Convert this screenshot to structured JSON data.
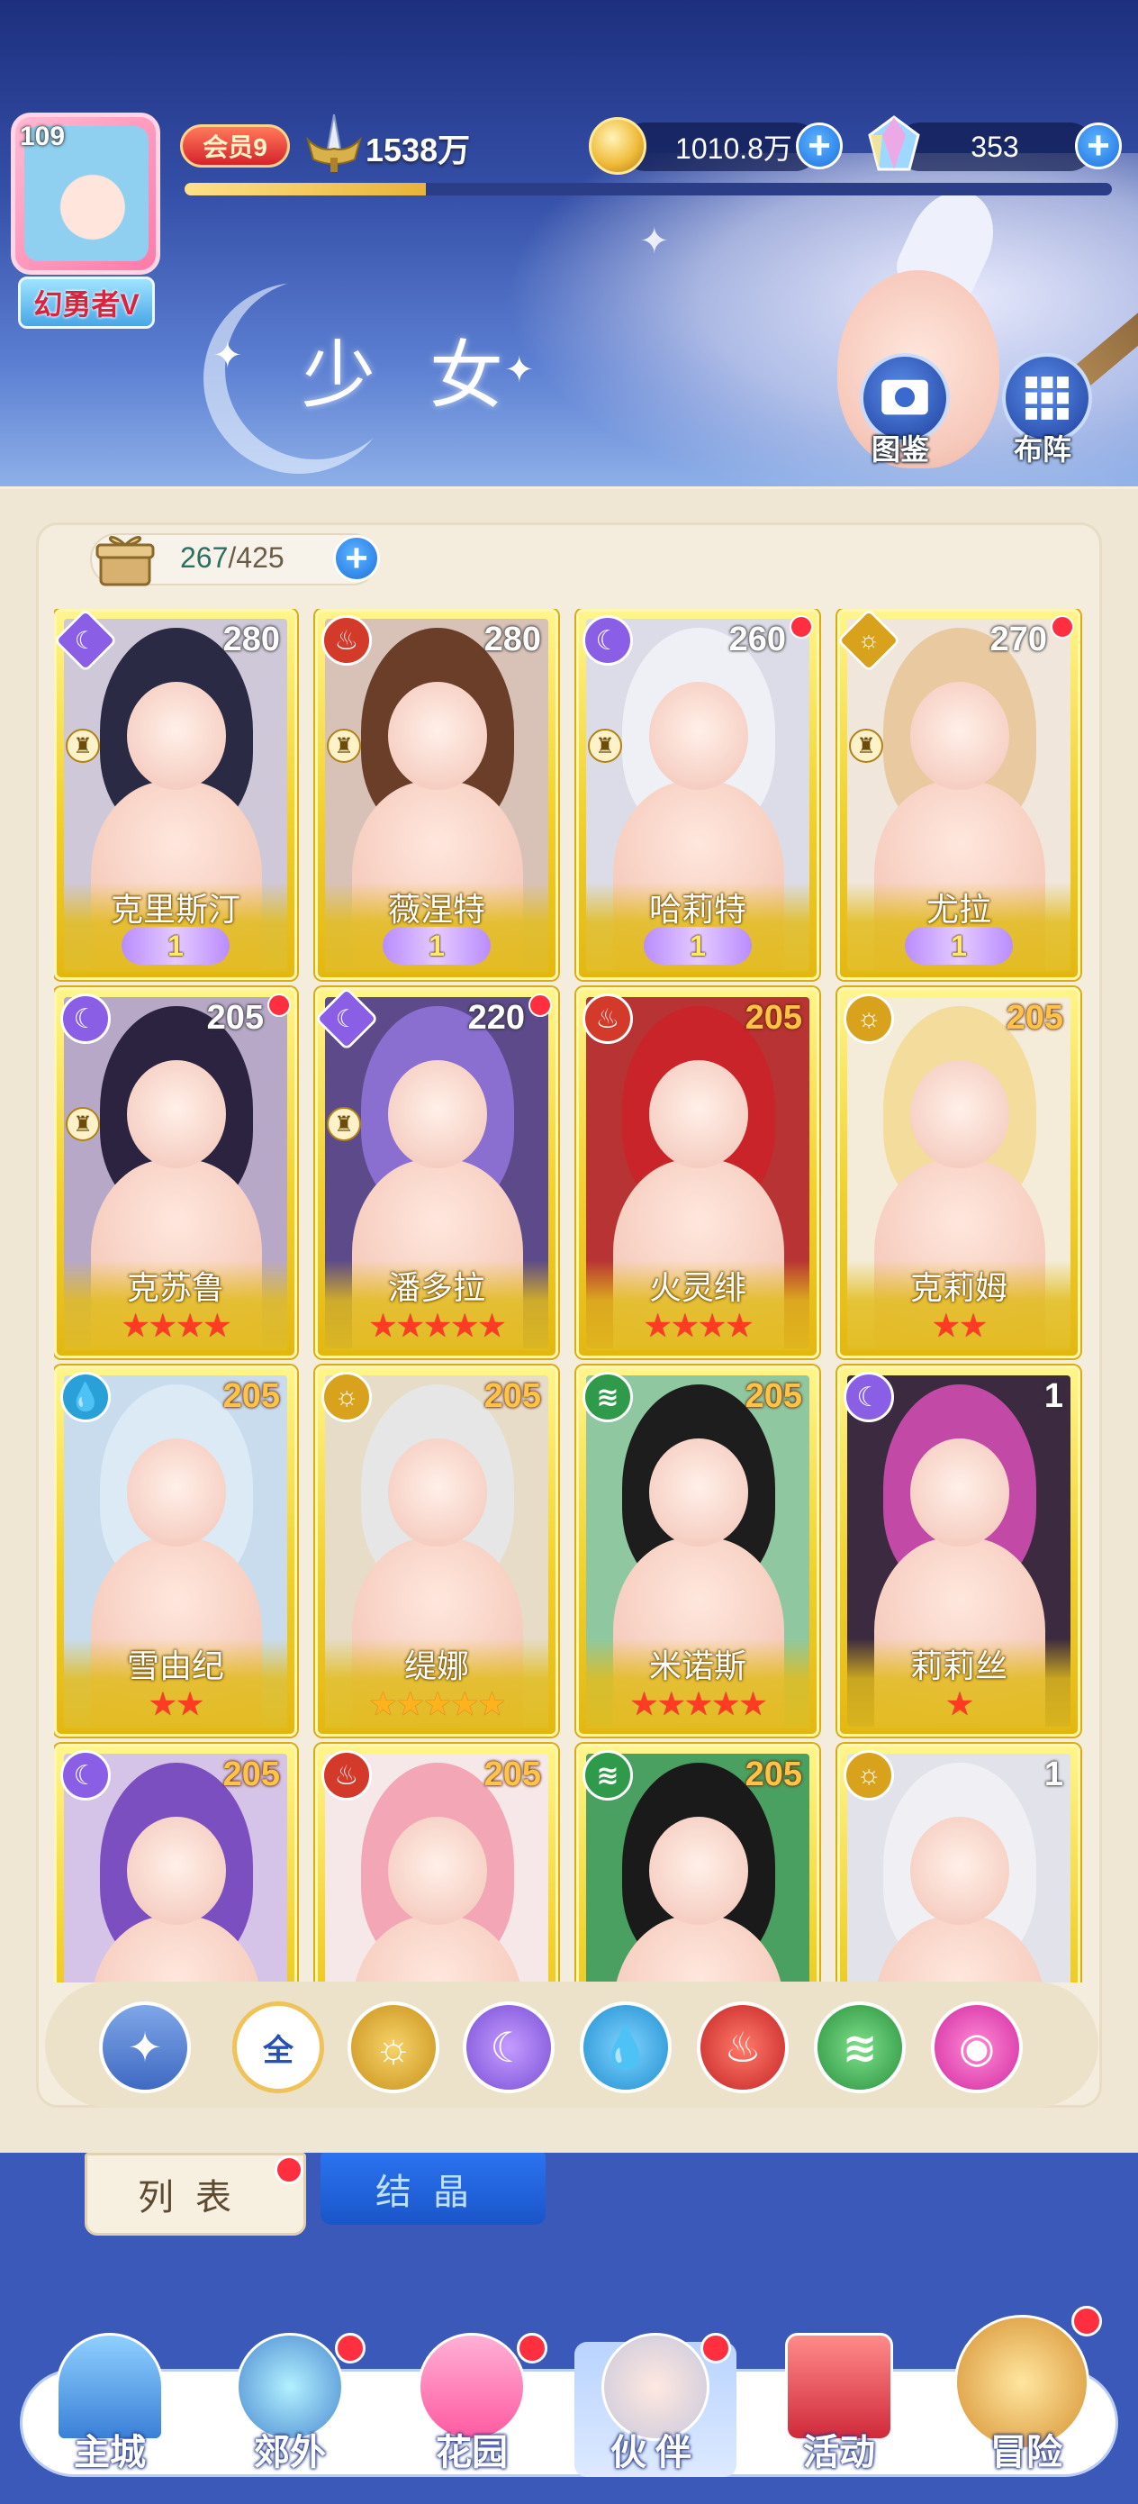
{
  "player": {
    "level": "109",
    "vip_title": "幻勇者V",
    "member": "会员9",
    "power": "1538万",
    "exp_percent": 26
  },
  "resources": {
    "gold": "1010.8万",
    "gems": "353"
  },
  "page_title": "少女",
  "side_buttons": {
    "codex": "图鉴",
    "formation": "布阵"
  },
  "roster": {
    "owned": "267",
    "capacity": "/425"
  },
  "colors": {
    "moon": "#8a5fe6",
    "fire": "#d33a2a",
    "sun": "#d9a21c",
    "water": "#2aa0d8",
    "wind": "#2f9b4a",
    "chaos": "#e23aa8",
    "all": "#3d69c9"
  },
  "cards": [
    {
      "name": "克里斯汀",
      "level": "280",
      "element": "moon",
      "badge": "wings",
      "rank": "1",
      "role": true,
      "dot": false,
      "hair": "#2a2a44",
      "bg": "#cfc8d8"
    },
    {
      "name": "薇涅特",
      "level": "280",
      "element": "fire",
      "badge": "wings",
      "rank": "1",
      "role": true,
      "dot": false,
      "hair": "#6b3e2a",
      "bg": "#d8c2b8"
    },
    {
      "name": "哈莉特",
      "level": "260",
      "element": "moon",
      "badge": "wings",
      "rank": "1",
      "role": true,
      "dot": true,
      "hair": "#eef0f6",
      "bg": "#dcdce8"
    },
    {
      "name": "尤拉",
      "level": "270",
      "element": "sun",
      "badge": "wings",
      "rank": "1",
      "role": true,
      "dot": true,
      "hair": "#e8c9a0",
      "bg": "#f0e6dc"
    },
    {
      "name": "克苏鲁",
      "level": "205",
      "element": "moon",
      "badge": "stars",
      "stars": 4,
      "role": true,
      "dot": true,
      "hair": "#2b2340",
      "bg": "#b8a8c8"
    },
    {
      "name": "潘多拉",
      "level": "220",
      "element": "moon",
      "badge": "stars",
      "stars": 5,
      "role": true,
      "dot": true,
      "hair": "#8a6fd0",
      "bg": "#5d4a8a"
    },
    {
      "name": "火灵绯",
      "level": "205",
      "element": "fire",
      "badge": "stars",
      "stars": 4,
      "role": false,
      "dot": false,
      "hair": "#c8242a",
      "bg": "#b83434"
    },
    {
      "name": "克莉姆",
      "level": "205",
      "element": "sun",
      "badge": "stars",
      "stars": 2,
      "role": false,
      "dot": false,
      "hair": "#f3dc9c",
      "bg": "#f4ecd8"
    },
    {
      "name": "雪由纪",
      "level": "205",
      "element": "water",
      "badge": "stars",
      "stars": 2,
      "role": false,
      "dot": false,
      "hair": "#dceaf6",
      "bg": "#c8dcee"
    },
    {
      "name": "缇娜",
      "level": "205",
      "element": "sun",
      "badge": "stars",
      "stars": 5,
      "role": false,
      "dot": false,
      "hair": "#e6e6e6",
      "bg": "#e6dcc8"
    },
    {
      "name": "米诺斯",
      "level": "205",
      "element": "wind",
      "badge": "stars",
      "stars": 5,
      "role": false,
      "dot": false,
      "hair": "#1d1d1d",
      "bg": "#8fc8a0"
    },
    {
      "name": "莉莉丝",
      "level": "1",
      "element": "moon",
      "badge": "stars",
      "stars": 1,
      "role": false,
      "dot": false,
      "hair": "#c24aa6",
      "bg": "#3c2a40"
    },
    {
      "name": "",
      "level": "205",
      "element": "moon",
      "badge": "none",
      "role": false,
      "dot": false,
      "hair": "#7c4fc0",
      "bg": "#d6c4e8"
    },
    {
      "name": "",
      "level": "205",
      "element": "fire",
      "badge": "none",
      "role": false,
      "dot": false,
      "hair": "#f2a6b6",
      "bg": "#f6e8e8"
    },
    {
      "name": "",
      "level": "205",
      "element": "wind",
      "badge": "none",
      "role": false,
      "dot": false,
      "hair": "#1a1a1a",
      "bg": "#4aa060"
    },
    {
      "name": "",
      "level": "1",
      "element": "sun",
      "badge": "none",
      "role": false,
      "dot": false,
      "hair": "#f0f0f4",
      "bg": "#e2e2ea"
    }
  ],
  "filters": [
    {
      "key": "special",
      "label": "✦"
    },
    {
      "key": "all",
      "label": "全"
    },
    {
      "key": "sun",
      "label": "☼"
    },
    {
      "key": "moon",
      "label": "☾"
    },
    {
      "key": "water",
      "label": "💧"
    },
    {
      "key": "fire",
      "label": "♨"
    },
    {
      "key": "wind",
      "label": "≋"
    },
    {
      "key": "chaos",
      "label": "◉"
    }
  ],
  "tabs": {
    "list": "列表",
    "crystal": "结晶"
  },
  "nav": [
    {
      "label": "主城",
      "dot": false
    },
    {
      "label": "郊外",
      "dot": true
    },
    {
      "label": "花园",
      "dot": true
    },
    {
      "label": "伙伴",
      "dot": true
    },
    {
      "label": "活动",
      "dot": false
    },
    {
      "label": "冒险",
      "dot": true
    }
  ],
  "element_glyphs": {
    "moon": "☾",
    "fire": "♨",
    "sun": "☼",
    "water": "💧",
    "wind": "≋"
  }
}
